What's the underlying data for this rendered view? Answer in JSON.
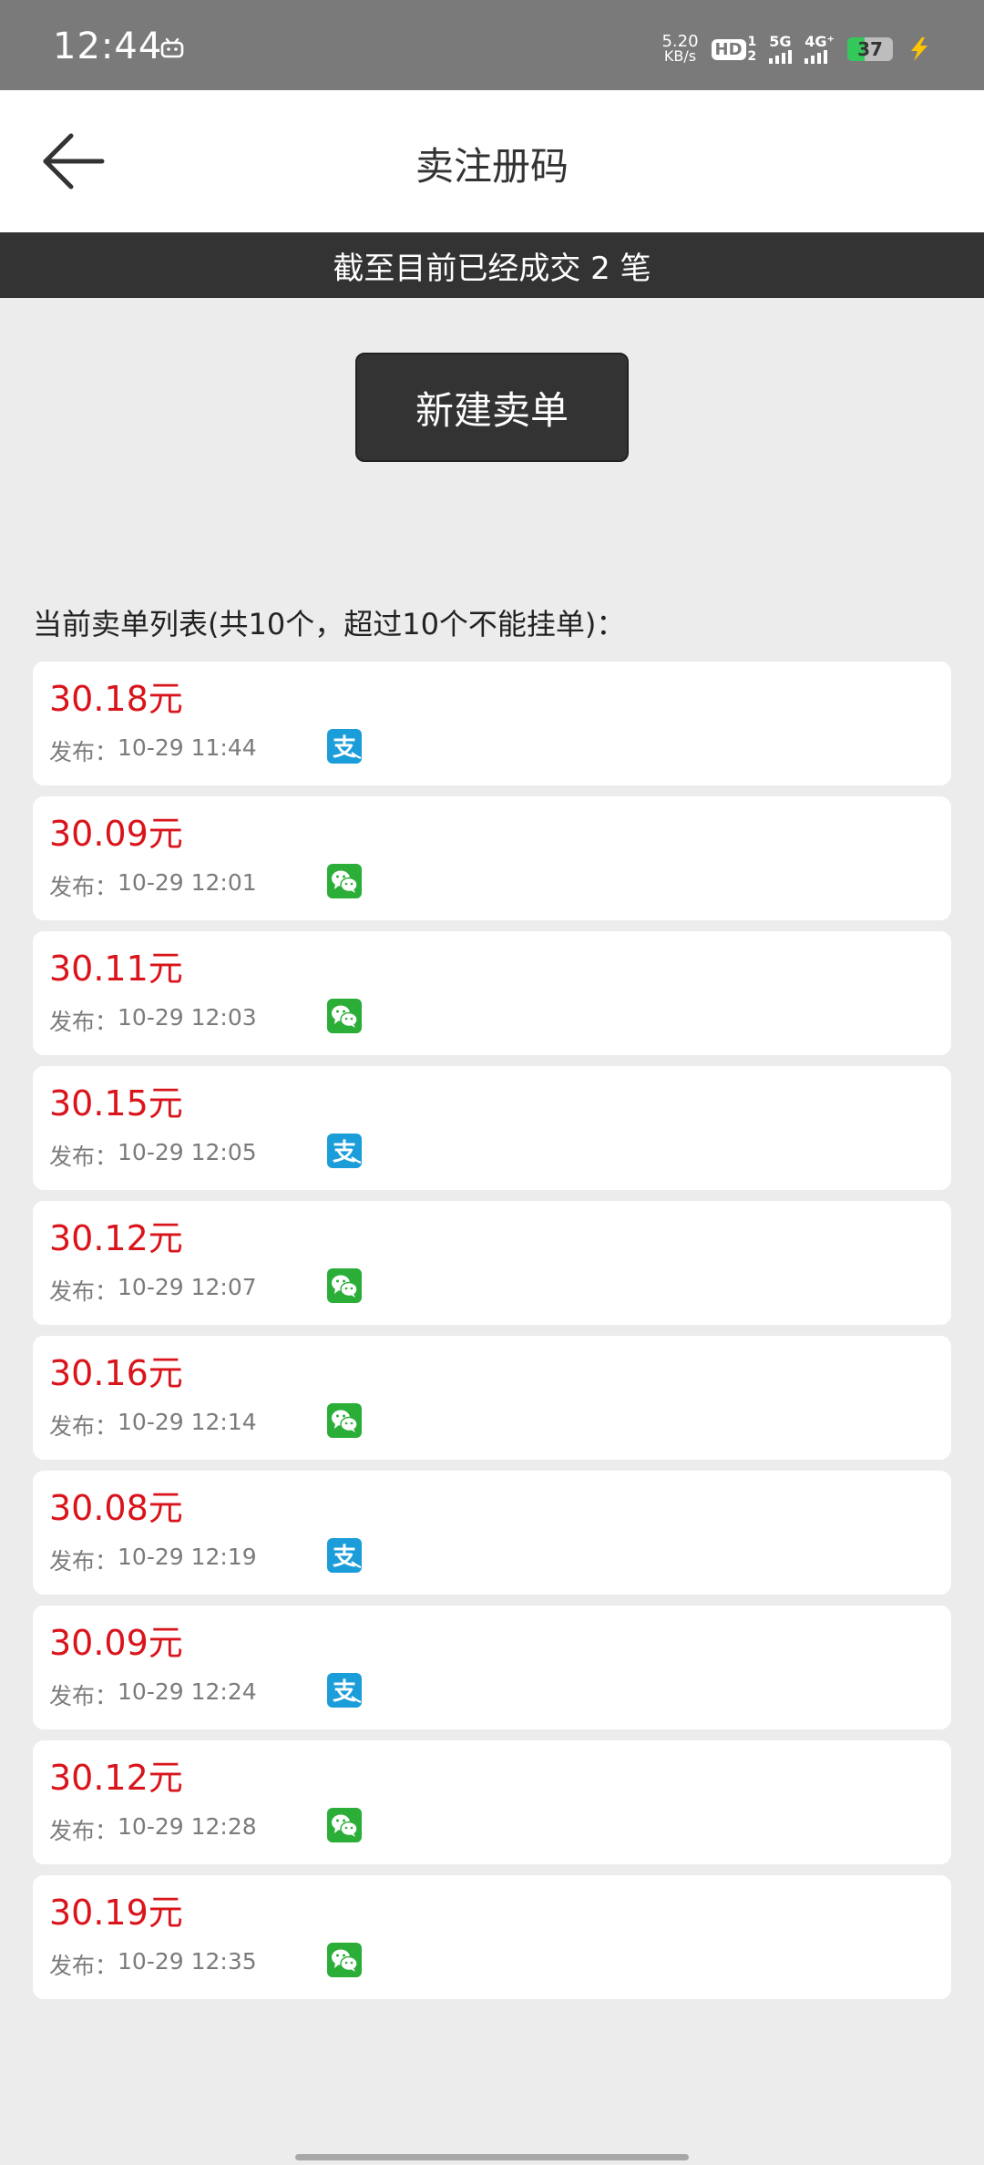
{
  "status_bar": {
    "time": "12:44",
    "net_speed_value": "5.20",
    "net_speed_unit": "KB/s",
    "hd_label": "HD",
    "hd_sim_top": "1",
    "hd_sim_bottom": "2",
    "signal1_label": "5G",
    "signal2_label": "4G⁺",
    "battery": "37",
    "battery_level": 0.37,
    "charging": true
  },
  "header": {
    "title": "卖注册码",
    "back_icon": "arrow-left-icon"
  },
  "summary": {
    "text": "截至目前已经成交 2 笔"
  },
  "actions": {
    "new_order_label": "新建卖单"
  },
  "list": {
    "title": "当前卖单列表(共10个，超过10个不能挂单)：",
    "publish_label": "发布：",
    "items": [
      {
        "price": "30.18元",
        "time": "10-29 11:44",
        "pay": "alipay"
      },
      {
        "price": "30.09元",
        "time": "10-29 12:01",
        "pay": "wechat"
      },
      {
        "price": "30.11元",
        "time": "10-29 12:03",
        "pay": "wechat"
      },
      {
        "price": "30.15元",
        "time": "10-29 12:05",
        "pay": "alipay"
      },
      {
        "price": "30.12元",
        "time": "10-29 12:07",
        "pay": "wechat"
      },
      {
        "price": "30.16元",
        "time": "10-29 12:14",
        "pay": "wechat"
      },
      {
        "price": "30.08元",
        "time": "10-29 12:19",
        "pay": "alipay"
      },
      {
        "price": "30.09元",
        "time": "10-29 12:24",
        "pay": "alipay"
      },
      {
        "price": "30.12元",
        "time": "10-29 12:28",
        "pay": "wechat"
      },
      {
        "price": "30.19元",
        "time": "10-29 12:35",
        "pay": "wechat"
      }
    ]
  },
  "colors": {
    "price": "#d9141b",
    "alipay": "#1a9dd9",
    "wechat": "#2aae38",
    "dark": "#333333",
    "status_bar": "#7a7a7a"
  }
}
